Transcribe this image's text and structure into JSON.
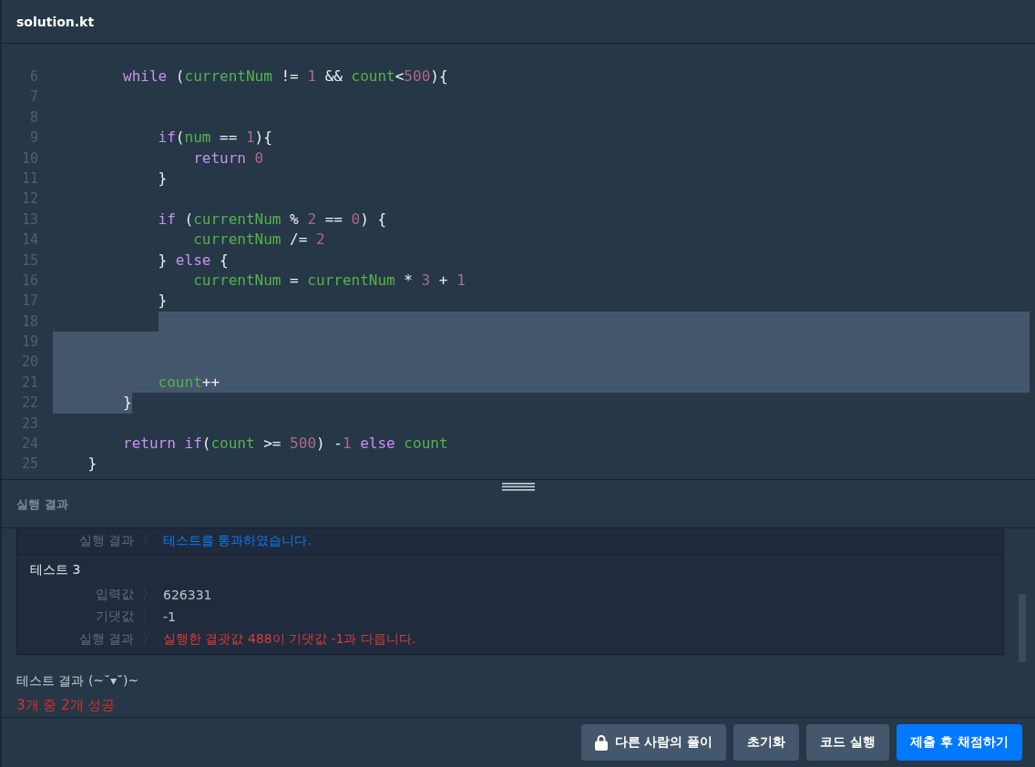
{
  "file": {
    "title": "solution.kt"
  },
  "code": {
    "lines": [
      {
        "no": "6",
        "kind": "normal",
        "tokens": [
          {
            "t": "        while ",
            "kind": "kw"
          },
          {
            "t": "(",
            "kind": "op"
          },
          {
            "t": "currentNum ",
            "kind": "var"
          },
          {
            "t": "!= ",
            "kind": "op"
          },
          {
            "t": "1 ",
            "kind": "num"
          },
          {
            "t": "&& ",
            "kind": "op"
          },
          {
            "t": "count",
            "kind": "var"
          },
          {
            "t": "<",
            "kind": "op"
          },
          {
            "t": "500",
            "kind": "num"
          },
          {
            "t": "){",
            "kind": "op"
          }
        ]
      },
      {
        "no": "7",
        "kind": "normal"
      },
      {
        "no": "8",
        "kind": "normal"
      },
      {
        "no": "9",
        "kind": "normal",
        "tokens": [
          {
            "t": "            if",
            "kind": "kw"
          },
          {
            "t": "(",
            "kind": "op"
          },
          {
            "t": "num ",
            "kind": "var"
          },
          {
            "t": "== ",
            "kind": "op"
          },
          {
            "t": "1",
            "kind": "num"
          },
          {
            "t": "){",
            "kind": "op"
          }
        ]
      },
      {
        "no": "10",
        "kind": "normal",
        "tokens": [
          {
            "t": "                return ",
            "kind": "kw"
          },
          {
            "t": "0",
            "kind": "num"
          }
        ]
      },
      {
        "no": "11",
        "kind": "normal",
        "tokens": [
          {
            "t": "            }",
            "kind": "op"
          }
        ]
      },
      {
        "no": "12",
        "kind": "normal"
      },
      {
        "no": "13",
        "kind": "normal",
        "tokens": [
          {
            "t": "            if ",
            "kind": "kw"
          },
          {
            "t": "(",
            "kind": "op"
          },
          {
            "t": "currentNum ",
            "kind": "var"
          },
          {
            "t": "% ",
            "kind": "op"
          },
          {
            "t": "2 ",
            "kind": "num"
          },
          {
            "t": "== ",
            "kind": "op"
          },
          {
            "t": "0",
            "kind": "num"
          },
          {
            "t": ") {",
            "kind": "op"
          }
        ]
      },
      {
        "no": "14",
        "kind": "normal",
        "tokens": [
          {
            "t": "                currentNum ",
            "kind": "var"
          },
          {
            "t": "/= ",
            "kind": "op"
          },
          {
            "t": "2",
            "kind": "num"
          }
        ]
      },
      {
        "no": "15",
        "kind": "normal",
        "tokens": [
          {
            "t": "            } ",
            "kind": "op"
          },
          {
            "t": "else ",
            "kind": "kw"
          },
          {
            "t": "{",
            "kind": "op"
          }
        ]
      },
      {
        "no": "16",
        "kind": "normal",
        "tokens": [
          {
            "t": "                currentNum ",
            "kind": "var"
          },
          {
            "t": "= ",
            "kind": "op"
          },
          {
            "t": "currentNum ",
            "kind": "var"
          },
          {
            "t": "* ",
            "kind": "op"
          },
          {
            "t": "3 ",
            "kind": "num"
          },
          {
            "t": "+ ",
            "kind": "op"
          },
          {
            "t": "1",
            "kind": "num"
          }
        ]
      },
      {
        "no": "17",
        "kind": "normal",
        "tokens": [
          {
            "t": "            }",
            "kind": "op"
          }
        ]
      },
      {
        "no": "18",
        "kind": "selection_start"
      },
      {
        "no": "19",
        "kind": "selected"
      },
      {
        "no": "20",
        "kind": "selected"
      },
      {
        "no": "21",
        "kind": "selected",
        "tokens": [
          {
            "t": "            count",
            "kind": "var"
          },
          {
            "t": "++",
            "kind": "op"
          }
        ]
      },
      {
        "no": "22",
        "kind": "selection_end",
        "tokens": [
          {
            "t": "        }",
            "kind": "op"
          }
        ]
      },
      {
        "no": "23",
        "kind": "normal"
      },
      {
        "no": "24",
        "kind": "normal",
        "tokens": [
          {
            "t": "        return ",
            "kind": "kw"
          },
          {
            "t": "if",
            "kind": "kw"
          },
          {
            "t": "(",
            "kind": "op"
          },
          {
            "t": "count ",
            "kind": "var"
          },
          {
            "t": ">= ",
            "kind": "op"
          },
          {
            "t": "500",
            "kind": "num"
          },
          {
            "t": ") -",
            "kind": "op"
          },
          {
            "t": "1 ",
            "kind": "num"
          },
          {
            "t": "else ",
            "kind": "kw"
          },
          {
            "t": "count",
            "kind": "var"
          }
        ]
      },
      {
        "no": "25",
        "kind": "normal",
        "tokens": [
          {
            "t": "    }",
            "kind": "op"
          }
        ]
      }
    ]
  },
  "output": {
    "title": "실행 결과",
    "tests": [
      {
        "rows": [
          {
            "label": "실행 결과",
            "sep": "〉",
            "value": "테스트를 통과하였습니다.",
            "kind": "pass"
          }
        ]
      },
      {
        "title": "테스트 3",
        "rows": [
          {
            "label": "입력값",
            "sep": "〉",
            "value": "626331",
            "kind": "plain"
          },
          {
            "label": "기댓값",
            "sep": "〉",
            "value": "-1",
            "kind": "plain"
          },
          {
            "label": "실행 결과",
            "sep": "〉",
            "value": "실행한 결괏값 488이 기댓값 -1과 다릅니다.",
            "kind": "fail"
          }
        ]
      }
    ],
    "summary": {
      "title": "테스트 결과 (~˘▾˘)~",
      "score": "3개 중 2개 성공"
    }
  },
  "buttons": [
    {
      "label": "다른 사람의 풀이",
      "kind": "locked"
    },
    {
      "label": "초기화",
      "kind": "secondary"
    },
    {
      "label": "코드 실행",
      "kind": "secondary"
    },
    {
      "label": "제출 후 채점하기",
      "kind": "primary"
    }
  ]
}
